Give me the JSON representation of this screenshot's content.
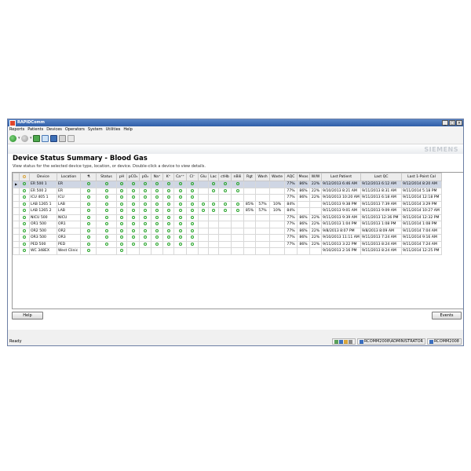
{
  "window": {
    "title": "RAPIDComm"
  },
  "menu": [
    "Reports",
    "Patients",
    "Devices",
    "Operators",
    "System",
    "Utilities",
    "Help"
  ],
  "brand": "SIEMENS",
  "page": {
    "title": "Device Status Summary - Blood Gas",
    "subtitle": "View status for the selected device type, location, or device. Double-click a device to view details."
  },
  "grid": {
    "columns": [
      "",
      "",
      "Device",
      "Location",
      "",
      "Status",
      "pH",
      "pCO₂",
      "pO₂",
      "Na⁺",
      "K⁺",
      "Ca⁺⁺",
      "Cl⁻",
      "Glu",
      "Lac",
      "ctHb",
      "nBili",
      "Rgt",
      "Wash",
      "Waste",
      "AQC",
      "Meas",
      "W/W",
      "Last Patient",
      "Last QC",
      "Last 1-Point Cal"
    ],
    "rows": [
      {
        "device": "ER 500 1",
        "location": "ER",
        "rgt": "",
        "wash": "",
        "waste": "",
        "aqc": "77%",
        "meas": "86%",
        "ww": "22%",
        "last_patient": "9/12/2013 6:46 AM",
        "last_qc": "9/12/2013 6:12 AM",
        "last_cal": "9/12/2014 8:20 AM",
        "s": [
          1,
          1,
          1,
          1,
          1,
          1,
          1,
          1,
          1,
          0,
          1,
          1,
          1
        ]
      },
      {
        "device": "ER 500 2",
        "location": "ER",
        "rgt": "",
        "wash": "",
        "waste": "",
        "aqc": "77%",
        "meas": "86%",
        "ww": "22%",
        "last_patient": "9/10/2013 8:21 AM",
        "last_qc": "9/11/2013 8:31 AM",
        "last_cal": "9/11/2014 5:18 PM",
        "s": [
          1,
          1,
          1,
          1,
          1,
          1,
          1,
          1,
          1,
          0,
          1,
          1,
          1
        ]
      },
      {
        "device": "ICU 405 1",
        "location": "ICU",
        "rgt": "",
        "wash": "",
        "waste": "",
        "aqc": "77%",
        "meas": "86%",
        "ww": "22%",
        "last_patient": "9/10/2013 10:20 AM",
        "last_qc": "9/11/2013 6:18 AM",
        "last_cal": "9/11/2014 12:18 PM",
        "s": [
          1,
          1,
          1,
          1,
          1,
          1,
          1,
          1,
          1,
          0,
          0,
          0,
          0
        ]
      },
      {
        "device": "LAB 1265 1",
        "location": "LAB",
        "rgt": "85%",
        "wash": "57%",
        "waste": "10%",
        "aqc": "84%",
        "meas": "",
        "ww": "",
        "last_patient": "9/11/2013 9:38 PM",
        "last_qc": "9/11/2013 7:39 AM",
        "last_cal": "9/11/2014 3:29 PM",
        "s": [
          1,
          1,
          1,
          1,
          1,
          1,
          1,
          1,
          1,
          1,
          1,
          1,
          1
        ]
      },
      {
        "device": "LAB 1265 2",
        "location": "LAB",
        "rgt": "85%",
        "wash": "57%",
        "waste": "10%",
        "aqc": "84%",
        "meas": "",
        "ww": "",
        "last_patient": "9/11/2013 9:01 AM",
        "last_qc": "9/11/2013 9:09 AM",
        "last_cal": "9/11/2014 10:27 AM",
        "s": [
          1,
          1,
          1,
          1,
          1,
          1,
          1,
          1,
          1,
          1,
          1,
          1,
          1
        ]
      },
      {
        "device": "NICU 500",
        "location": "NICU",
        "rgt": "",
        "wash": "",
        "waste": "",
        "aqc": "77%",
        "meas": "86%",
        "ww": "22%",
        "last_patient": "9/11/2013 9:39 AM",
        "last_qc": "9/11/2013 12:36 PM",
        "last_cal": "9/11/2014 12:32 PM",
        "s": [
          1,
          1,
          1,
          1,
          1,
          1,
          1,
          1,
          1,
          0,
          0,
          0,
          0
        ]
      },
      {
        "device": "OR1 500",
        "location": "OR1",
        "rgt": "",
        "wash": "",
        "waste": "",
        "aqc": "77%",
        "meas": "86%",
        "ww": "22%",
        "last_patient": "9/11/2013 1:04 PM",
        "last_qc": "9/11/2013 1:08 PM",
        "last_cal": "9/11/2014 1:08 PM",
        "s": [
          1,
          1,
          1,
          1,
          1,
          1,
          1,
          1,
          1,
          0,
          0,
          0,
          0
        ]
      },
      {
        "device": "OR2 500",
        "location": "OR2",
        "rgt": "",
        "wash": "",
        "waste": "",
        "aqc": "77%",
        "meas": "86%",
        "ww": "22%",
        "last_patient": "9/8/2013 8:07 PM",
        "last_qc": "9/8/2013 8:09 AM",
        "last_cal": "9/11/2014 7:04 AM",
        "s": [
          1,
          1,
          1,
          1,
          1,
          1,
          1,
          1,
          1,
          0,
          0,
          0,
          0
        ]
      },
      {
        "device": "OR3 500",
        "location": "OR3",
        "rgt": "",
        "wash": "",
        "waste": "",
        "aqc": "77%",
        "meas": "86%",
        "ww": "22%",
        "last_patient": "9/10/2013 11:11 AM",
        "last_qc": "9/11/2013 7:24 AM",
        "last_cal": "9/11/2014 9:16 AM",
        "s": [
          1,
          1,
          1,
          1,
          1,
          1,
          1,
          1,
          1,
          0,
          0,
          0,
          0
        ]
      },
      {
        "device": "PED 500",
        "location": "PED",
        "rgt": "",
        "wash": "",
        "waste": "",
        "aqc": "77%",
        "meas": "86%",
        "ww": "22%",
        "last_patient": "9/11/2013 3:22 PM",
        "last_qc": "9/11/2013 8:24 AM",
        "last_cal": "9/11/2014 7:24 AM",
        "s": [
          1,
          1,
          1,
          1,
          1,
          1,
          1,
          1,
          1,
          0,
          0,
          0,
          0
        ]
      },
      {
        "device": "WC 348EX",
        "location": "West Clinic",
        "rgt": "",
        "wash": "",
        "waste": "",
        "aqc": "",
        "meas": "",
        "ww": "",
        "last_patient": "9/10/2013 2:16 PM",
        "last_qc": "9/11/2013 8:24 AM",
        "last_cal": "9/11/2014 12:25 PM",
        "s": [
          1,
          0,
          1,
          0,
          0,
          0,
          0,
          0,
          0,
          0,
          0,
          0,
          0
        ]
      }
    ]
  },
  "buttons": {
    "help": "Help",
    "events": "Events"
  },
  "status": {
    "ready": "Ready",
    "server": "RCOMM2008\\ADMINISTRATOR",
    "host": "RCOMM2008"
  },
  "colors": {
    "ok": "#27a52a",
    "selected_row": "#cfd6e4",
    "titlebar": "#2f5ea8"
  },
  "icons": [
    "back-arrow-icon",
    "forward-arrow-icon",
    "refresh-icon",
    "device-view-icon",
    "grid-view-icon",
    "report-icon",
    "flag-icon",
    "status-circle-icon"
  ]
}
